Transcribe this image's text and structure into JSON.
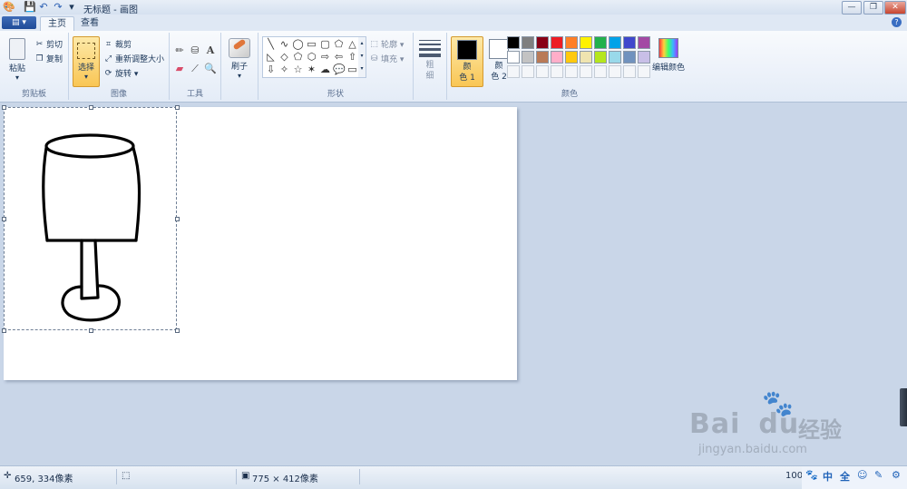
{
  "titlebar": {
    "title": "无标题 - 画图",
    "save_icon": "💾",
    "undo_icon": "↶",
    "redo_icon": "↷",
    "dropdown_icon": "▾",
    "minimize": "—",
    "maximize": "❐",
    "close": "✕"
  },
  "tabs": {
    "file_menu": "▤ ▾",
    "home": "主页",
    "view": "查看",
    "help": "?"
  },
  "ribbon": {
    "clipboard": {
      "label": "剪贴板",
      "paste": "粘贴",
      "cut": "剪切",
      "copy": "复制"
    },
    "image": {
      "label": "图像",
      "select": "选择",
      "crop": "裁剪",
      "resize": "重新调整大小",
      "rotate": "旋转"
    },
    "tools": {
      "label": "工具",
      "text_tool": "A"
    },
    "brushes": {
      "label": "刷子"
    },
    "shapes": {
      "label": "形状",
      "outline": "轮廓",
      "fill": "填充",
      "items": [
        "╲",
        "∿",
        "◯",
        "▭",
        "▢",
        "⬠",
        "△",
        "◺",
        "◇",
        "⬠",
        "⬡",
        "⇨",
        "⇦",
        "⇧",
        "⇩",
        "✧",
        "☆",
        "✶",
        "☁",
        "💬",
        "▭"
      ]
    },
    "size": {
      "label": "粗\n细"
    },
    "colors": {
      "label": "颜色",
      "color1": "颜\n色 1",
      "color2": "颜\n色 2",
      "edit": "编辑颜色",
      "color1_value": "#000000",
      "color2_value": "#ffffff",
      "palette_row1": [
        "#000000",
        "#7f7f7f",
        "#880015",
        "#ed1c24",
        "#ff7f27",
        "#fff200",
        "#22b14c",
        "#00a2e8",
        "#3f48cc",
        "#a349a4"
      ],
      "palette_row2": [
        "#ffffff",
        "#c3c3c3",
        "#b97a57",
        "#ffaec9",
        "#ffc90e",
        "#efe4b0",
        "#b5e61d",
        "#99d9ea",
        "#7092be",
        "#c8bfe7"
      ],
      "palette_row3_count": 10
    }
  },
  "statusbar": {
    "cursor_pos": "659, 334像素",
    "canvas_size": "775 × 412像素",
    "zoom": "100",
    "ime": [
      "🐾",
      "中",
      "全",
      "☺",
      "✎",
      "⚙"
    ]
  },
  "watermark": {
    "brand": "Bai",
    "brand2": "du",
    "cn": "经验",
    "url": "jingyan.baidu.com"
  }
}
